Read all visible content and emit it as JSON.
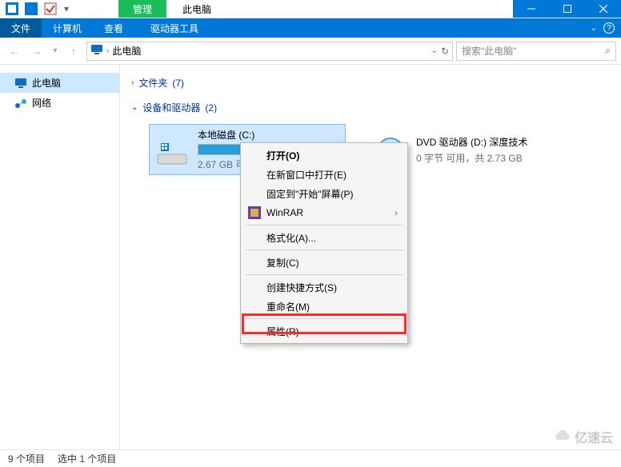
{
  "title_tab_manage": "管理",
  "title_tab_location": "此电脑",
  "ribbon": {
    "file": "文件",
    "computer": "计算机",
    "view": "查看",
    "tools": "驱动器工具"
  },
  "address": {
    "location": "此电脑"
  },
  "search": {
    "placeholder": "搜索\"此电脑\""
  },
  "sidebar": {
    "this_pc": "此电脑",
    "network": "网络"
  },
  "groups": {
    "folders": {
      "label": "文件夹",
      "count": "(7)"
    },
    "devices": {
      "label": "设备和驱动器",
      "count": "(2)"
    }
  },
  "drives": {
    "c": {
      "name": "本地磁盘 (C:)",
      "sub": "2.67 GB 可用",
      "fill_pct": 62
    },
    "d": {
      "name": "DVD 驱动器 (D:) 深度技术",
      "sub": "0 字节 可用，共 2.73 GB"
    }
  },
  "ctx": {
    "open": "打开(O)",
    "open_new": "在新窗口中打开(E)",
    "pin_start": "固定到\"开始\"屏幕(P)",
    "winrar": "WinRAR",
    "format": "格式化(A)...",
    "copy": "复制(C)",
    "shortcut": "创建快捷方式(S)",
    "rename": "重命名(M)",
    "properties": "属性(R)"
  },
  "status": {
    "items": "9 个项目",
    "selected": "选中 1 个项目"
  },
  "watermark": "亿速云"
}
